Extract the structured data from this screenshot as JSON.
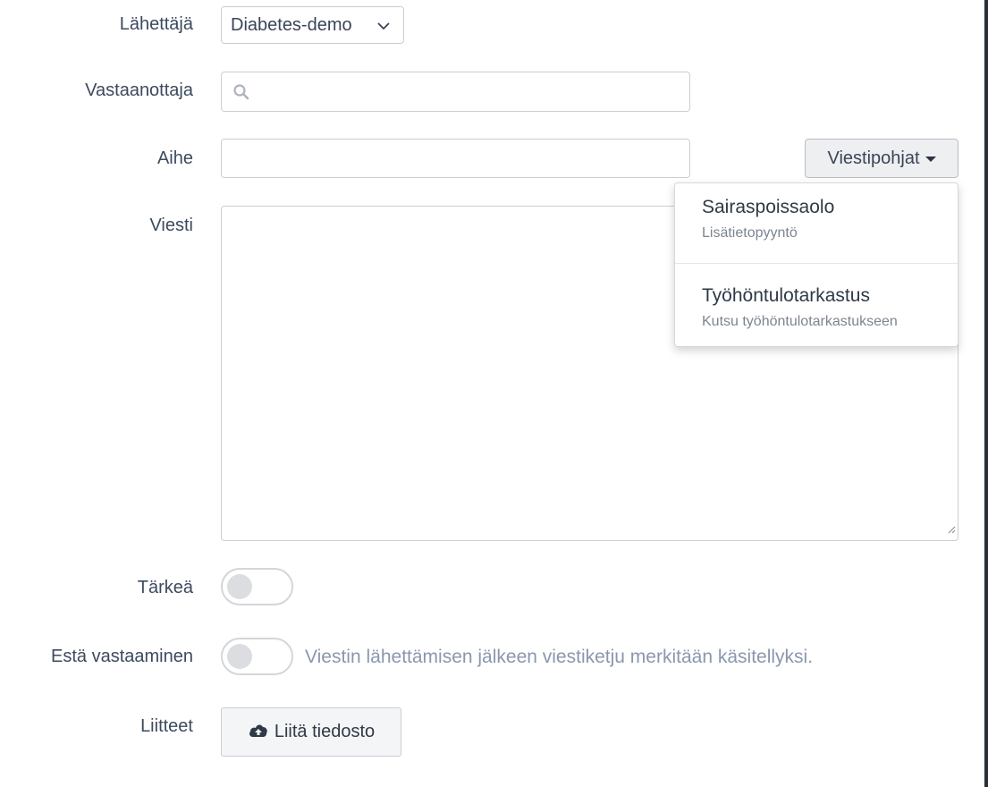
{
  "form": {
    "sender": {
      "label": "Lähettäjä",
      "value": "Diabetes-demo",
      "icon": "chevron-down-icon"
    },
    "recipient": {
      "label": "Vastaanottaja",
      "icon": "search-icon",
      "value": ""
    },
    "subject": {
      "label": "Aihe",
      "value": ""
    },
    "templates_button": {
      "label": "Viestipohjat"
    },
    "templates_menu": [
      {
        "title": "Sairaspoissaolo",
        "subtitle": "Lisätietopyyntö"
      },
      {
        "title": "Työhöntulotarkastus",
        "subtitle": "Kutsu työhöntulotarkastukseen"
      }
    ],
    "message": {
      "label": "Viesti",
      "value": ""
    },
    "important": {
      "label": "Tärkeä",
      "on": false
    },
    "prevent_reply": {
      "label": "Estä vastaaminen",
      "on": false,
      "hint": "Viestin lähettämisen jälkeen viestiketju merkitään käsitellyksi."
    },
    "attachments": {
      "label": "Liitteet",
      "button": "Liitä tiedosto",
      "icon": "cloud-upload-icon"
    }
  }
}
